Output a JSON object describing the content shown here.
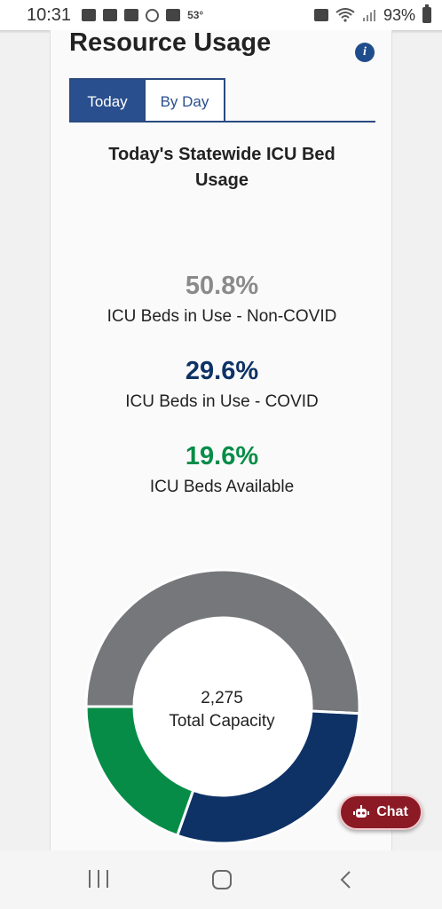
{
  "status_bar": {
    "time": "10:31",
    "temperature": "53°",
    "battery": "93%",
    "icons": [
      "notification-icon",
      "mail-icon",
      "mail-icon",
      "shield-icon",
      "image-icon",
      "recycle-icon",
      "wifi-icon",
      "signal-icon",
      "battery-icon"
    ]
  },
  "card": {
    "title": "Resource Usage",
    "info_icon": "info-icon",
    "tabs": [
      {
        "label": "Today",
        "active": true
      },
      {
        "label": "By Day",
        "active": false
      }
    ],
    "subtitle": "Today's Statewide ICU Bed Usage",
    "stats": [
      {
        "value": "50.8%",
        "label": "ICU Beds in Use - Non-COVID",
        "color": "#8a8a8a"
      },
      {
        "value": "29.6%",
        "label": "ICU Beds in Use - COVID",
        "color": "#0e3266"
      },
      {
        "value": "19.6%",
        "label": "ICU Beds Available",
        "color": "#078c48"
      }
    ],
    "donut_center": {
      "value": "2,275",
      "label": "Total Capacity"
    }
  },
  "chart_data": {
    "type": "pie",
    "categories": [
      "ICU Beds in Use - Non-COVID",
      "ICU Beds in Use - COVID",
      "ICU Beds Available"
    ],
    "values": [
      50.8,
      29.6,
      19.6
    ],
    "colors": [
      "#76777b",
      "#0e3266",
      "#078c48"
    ]
  },
  "chat_button": {
    "label": "Chat",
    "icon": "bot-icon"
  },
  "nav_bar": {
    "icons": [
      "recent-apps-icon",
      "home-icon",
      "back-icon"
    ]
  }
}
